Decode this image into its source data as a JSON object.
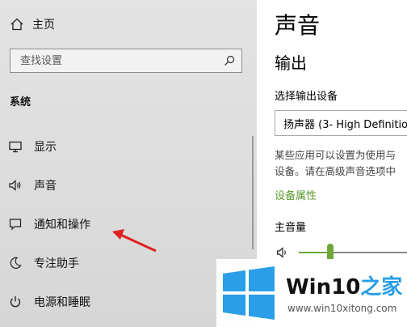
{
  "sidebar": {
    "home_label": "主页",
    "search_placeholder": "查找设置",
    "section_title": "系统",
    "items": [
      {
        "label": "显示",
        "icon": "display-icon"
      },
      {
        "label": "声音",
        "icon": "speaker-icon"
      },
      {
        "label": "通知和操作",
        "icon": "message-icon"
      },
      {
        "label": "专注助手",
        "icon": "moon-icon"
      },
      {
        "label": "电源和睡眠",
        "icon": "power-icon"
      }
    ]
  },
  "main": {
    "title": "声音",
    "output_heading": "输出",
    "output_device_label": "选择输出设备",
    "output_device_value": "扬声器 (3- High Definition",
    "description_lines": [
      "某些应用可以设置为使用与",
      "设备。请在高级声音选项中"
    ],
    "device_properties_link": "设备属性",
    "master_volume_label": "主音量",
    "volume_fraction": 0.29
  },
  "watermark": {
    "brand_prefix": "Win10",
    "brand_suffix": "之家",
    "url": "www.win10xitong.com"
  },
  "colors": {
    "accent": "#6ea63a",
    "link": "#5a9a2b",
    "arrow": "#e02020",
    "logo_blue": "#2a9ee8"
  }
}
